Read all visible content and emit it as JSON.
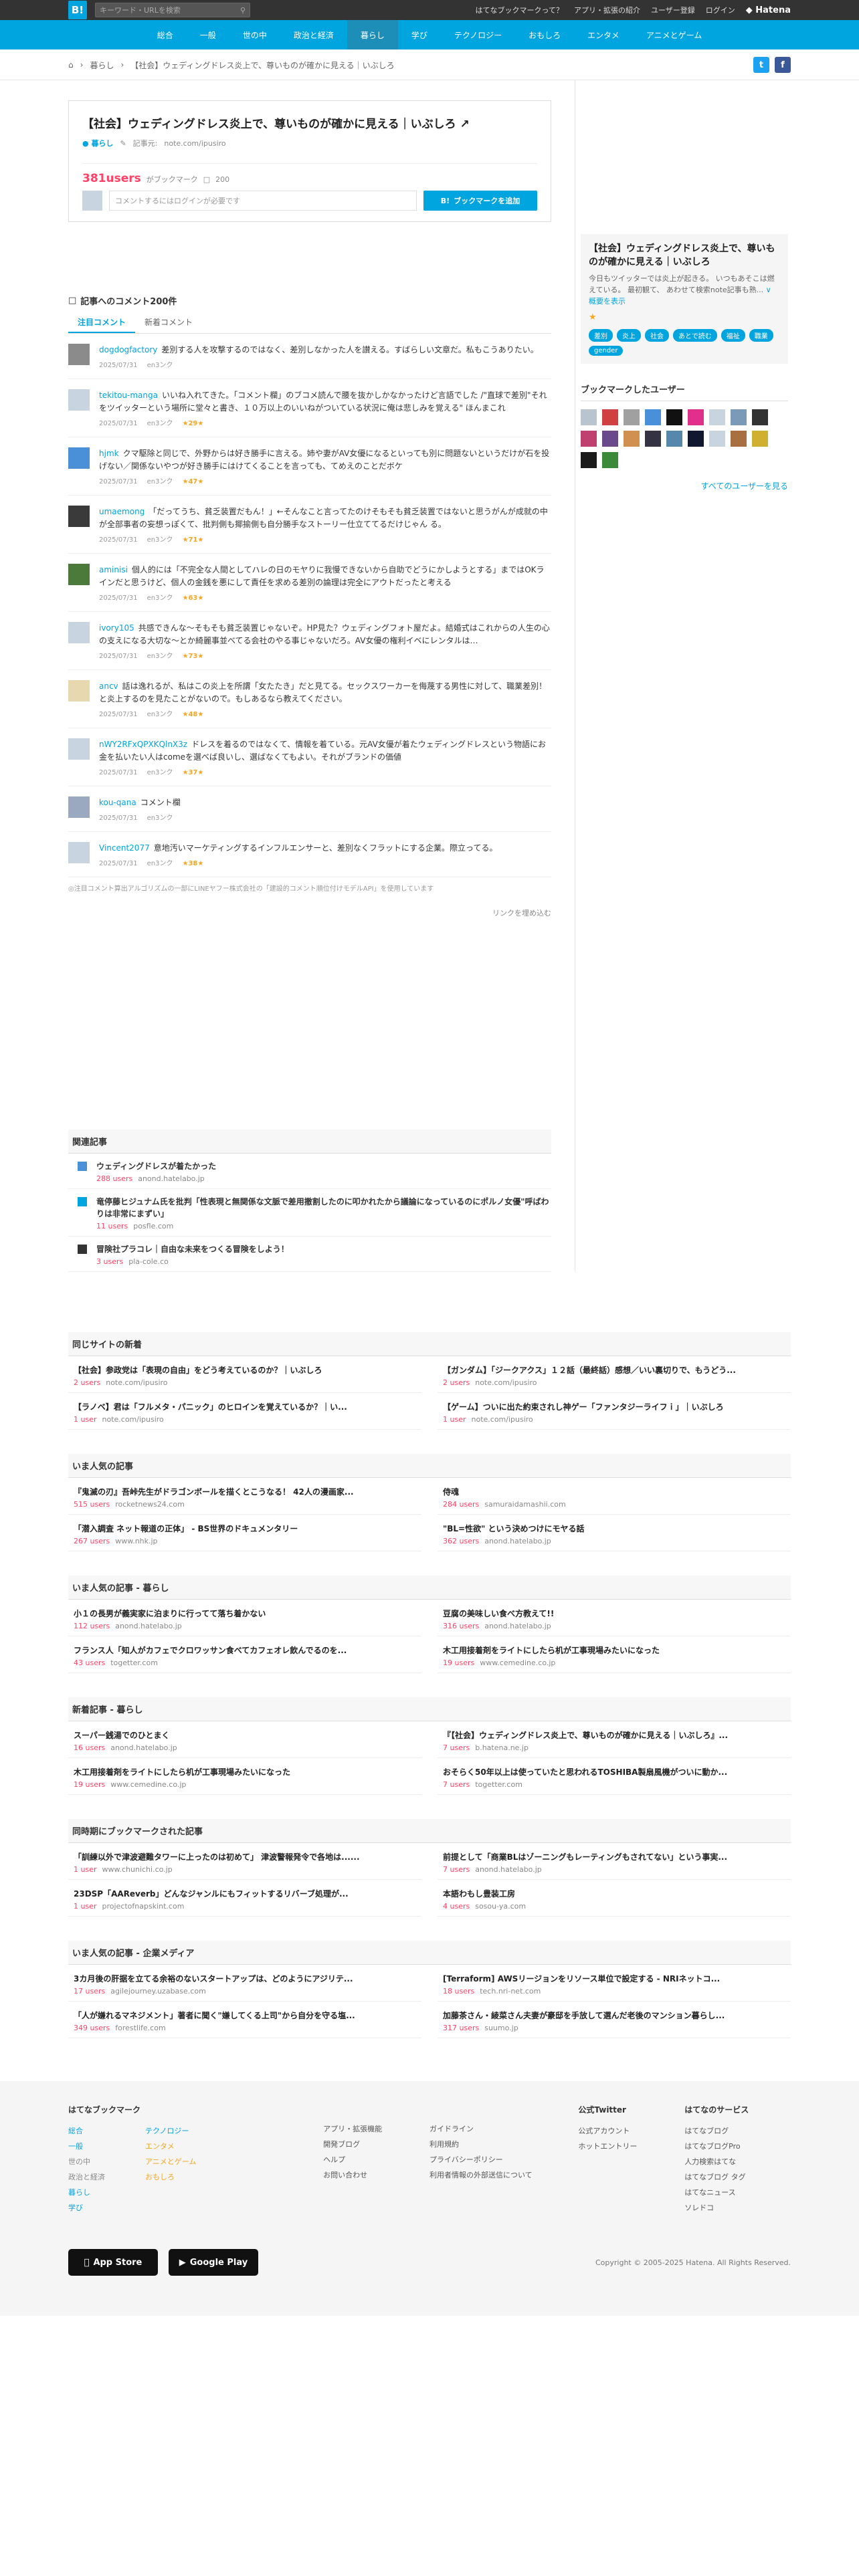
{
  "topbar": {
    "logo": "B!",
    "search_placeholder": "キーワード・URLを検索",
    "links": [
      "はてなブックマークって？",
      "アプリ・拡張の紹介",
      "ユーザー登録",
      "ログイン"
    ],
    "brand": "Hatena"
  },
  "categories": [
    "総合",
    "一般",
    "世の中",
    "政治と経済",
    "暮らし",
    "学び",
    "テクノロジー",
    "おもしろ",
    "エンタメ",
    "アニメとゲーム"
  ],
  "breadcrumb": {
    "section": "暮らし",
    "title": "【社会】ウェディングドレス炎上で、尊いものが確かに見える｜いぶしろ"
  },
  "entry": {
    "title": "【社会】ウェディングドレス炎上で、尊いものが確かに見える｜いぶしろ",
    "category": "暮らし",
    "meta_label": "記事元:",
    "domain": "note.com/ipusiro",
    "users": "381users",
    "users_suffix": "がブックマーク",
    "comment_count": "200",
    "comment_placeholder": "コメントするにはログインが必要です",
    "add_button": "ブックマークを追加"
  },
  "comments_section": {
    "heading": "記事へのコメント200件",
    "tab_popular": "注目コメント",
    "tab_new": "新着コメント",
    "items": [
      {
        "user": "dogdogfactory",
        "text": "差別する人を攻撃するのではなく、差別しなかった人を讃える。すばらしい文章だ。私もこうありたい。",
        "date": "2025/07/31",
        "link": "en3ンク",
        "stars": ""
      },
      {
        "user": "tekitou-manga",
        "text": "いいね入れてきた。「コメント欄」のブコメ読んで腰を抜かしかなかったけど言語でした /\"直球で差別\"それをツイッターという場所に堂々と書き、１０万以上のいいねがついている状況に俺は悲しみを覚える\" ほんまこれ",
        "date": "2025/07/31",
        "link": "en3ンク",
        "stars": "★29★"
      },
      {
        "user": "hjmk",
        "text": "クマ駆除と同じで、外野からは好き勝手に言える。姉や妻がAV女優になるといっても別に問題ないというだけが石を投げない／関係ないやつが好き勝手にはけてくることを言っても、てめえのことだボケ",
        "date": "2025/07/31",
        "link": "en3ンク",
        "stars": "★47★"
      },
      {
        "user": "umaemong",
        "text": "「だってうち、貧乏装置だもん！」←そんなこと言ってたのけそもそも貧乏装置ではないと思うがんが成就の中が全部事者の妄想っぽくて、批判側も揶揄側も自分勝手なストーリー仕立ててるだけじゃん る。",
        "date": "2025/07/31",
        "link": "en3ンク",
        "stars": "★71★"
      },
      {
        "user": "aminisi",
        "text": "個人的には「不完全な人間としてハレの日のモヤりに我慢できないから自助でどうにかしようとする」まではOKラインだと思うけど、個人の金銭を悪にして責任を求める差別の論理は完全にアウトだったと考える",
        "date": "2025/07/31",
        "link": "en3ンク",
        "stars": "★63★"
      },
      {
        "user": "ivory105",
        "text": "共感できんな～そもそも貧乏装置じゃないぞ。HP見た？ウェディングフォト屋だよ。結婚式はこれからの人生の心の支えになる大切な～とか綺麗事並べてる会社のやる事じゃないだろ。AV女優の権利イベにレンタルは…",
        "date": "2025/07/31",
        "link": "en3ンク",
        "stars": "★73★"
      },
      {
        "user": "ancv",
        "text": "話は逸れるが、私はこの炎上を所謂「女たたき」だと見てる。セックスワーカーを侮蔑する男性に対して、職業差別！と炎上するのを見たことがないので。もしあるなら教えてください。",
        "date": "2025/07/31",
        "link": "en3ンク",
        "stars": "★48★"
      },
      {
        "user": "nWY2RFxQPXKQlnX3z",
        "text": "ドレスを着るのではなくて、情報を着ている。元AV女優が着たウェディングドレスという物語にお金を払いたい人はcomeを選べば良いし、選ばなくてもよい。それがブランドの価値",
        "date": "2025/07/31",
        "link": "en3ンク",
        "stars": "★37★"
      },
      {
        "user": "kou-qana",
        "text": "コメント欄",
        "date": "2025/07/31",
        "link": "en3ンク",
        "stars": ""
      },
      {
        "user": "Vincent2077",
        "text": "意地汚いマーケティングするインフルエンサーと、差別なくフラットにする企業。際立ってる。",
        "date": "2025/07/31",
        "link": "en3ンク",
        "stars": "★38★"
      }
    ],
    "note": "◎注目コメント算出アルゴリズムの一部にLINEヤフー株式会社の「建設的コメント順位付けモデルAPI」を使用しています",
    "more": "リンクを埋め込む"
  },
  "related": {
    "heading": "関連記事",
    "items": [
      {
        "title": "ウェディングドレスが着たかった",
        "users": "288 users",
        "domain": "anond.hatelabo.jp"
      },
      {
        "title": "竜停藤ヒジュナム氏を批判「性表現と無関係な文脈で差用撤割したのに叩かれたから議論になっているのにポルノ女優\"呼ばわりは非常にまずい」",
        "users": "11 users",
        "domain": "posfle.com"
      },
      {
        "title": "冒険社プラコレ｜自由な未来をつくる冒険をしよう！",
        "users": "3 users",
        "domain": "pla-cole.co"
      }
    ]
  },
  "sidebar": {
    "title": "【社会】ウェディングドレス炎上で、尊いものが確かに見える｜いぶしろ",
    "desc": "今日もツイッターでは炎上が起きる。 いつもあそこは燃えている。 最初観て、 あわせて検索note記事も熟...",
    "more_link": "概要を表示",
    "star": "★",
    "tags": [
      "差別",
      "炎上",
      "社会",
      "あとで読む",
      "福祉",
      "職業",
      "gender"
    ],
    "bookmark_users_heading": "ブックマークしたユーザー",
    "all_users": "すべてのユーザーを見る"
  },
  "lower_sections": [
    {
      "heading": "同じサイトの新着",
      "items": [
        {
          "title": "【社会】参政党は「表現の自由」をどう考えているのか？｜いぶしろ",
          "users": "2 users",
          "domain": "note.com/ipusiro"
        },
        {
          "title": "【ガンダム】「ジークアクス」１２話（最終話）感想／いい裏切りで、もうどう...",
          "users": "2 users",
          "domain": "note.com/ipusiro"
        },
        {
          "title": "【ラノベ】君は「フルメタ・パニック」のヒロインを覚えているか？｜い...",
          "users": "1 user",
          "domain": "note.com/ipusiro"
        },
        {
          "title": "【ゲーム】ついに出た約束されし神ゲー「ファンタジーライフｉ」｜いぶしろ",
          "users": "1 user",
          "domain": "note.com/ipusiro"
        }
      ]
    },
    {
      "heading": "いま人気の記事",
      "items": [
        {
          "title": "『鬼滅の刃』吾峠先生がドラゴンボールを描くとこうなる！ 42人の漫画家...",
          "users": "515 users",
          "domain": "rocketnews24.com"
        },
        {
          "title": "侍魂",
          "users": "284 users",
          "domain": "samuraidamashii.com"
        },
        {
          "title": "「潜入調査 ネット報道の正体」 - BS世界のドキュメンタリー",
          "users": "267 users",
          "domain": "www.nhk.jp"
        },
        {
          "title": "\"BL=性欲\" という決めつけにモヤる話",
          "users": "362 users",
          "domain": "anond.hatelabo.jp"
        }
      ]
    },
    {
      "heading": "いま人気の記事 - 暮らし",
      "items": [
        {
          "title": "小１の長男が義実家に泊まりに行ってて落ち着かない",
          "users": "112 users",
          "domain": "anond.hatelabo.jp"
        },
        {
          "title": "豆腐の美味しい食べ方教えて!!",
          "users": "316 users",
          "domain": "anond.hatelabo.jp"
        },
        {
          "title": "フランス人「知人がカフェでクロワッサン食べてカフェオレ飲んでるのを...",
          "users": "43 users",
          "domain": "togetter.com"
        },
        {
          "title": "木工用接着剤をライトにしたら机が工事現場みたいになった",
          "users": "19 users",
          "domain": "www.cemedine.co.jp"
        }
      ]
    },
    {
      "heading": "新着記事 - 暮らし",
      "items": [
        {
          "title": "スーパー銭湯でのひとまく",
          "users": "16 users",
          "domain": "anond.hatelabo.jp"
        },
        {
          "title": "『【社会】ウェディングドレス炎上で、尊いものが確かに見える｜いぶしろ』...",
          "users": "7 users",
          "domain": "b.hatena.ne.jp"
        },
        {
          "title": "木工用接着剤をライトにしたら机が工事現場みたいになった",
          "users": "19 users",
          "domain": "www.cemedine.co.jp"
        },
        {
          "title": "おそらく50年以上は使っていたと思われるTOSHIBA製扇風機がついに動か...",
          "users": "7 users",
          "domain": "togetter.com"
        }
      ]
    },
    {
      "heading": "同時期にブックマークされた記事",
      "items": [
        {
          "title": "「訓練以外で津波避難タワーに上ったのは初めて」 津波警報発令で各地は......",
          "users": "1 user",
          "domain": "www.chunichi.co.jp"
        },
        {
          "title": "前提として「商業BLはゾーニングもレーティングもされてない」という事実...",
          "users": "7 users",
          "domain": "anond.hatelabo.jp"
        },
        {
          "title": "23DSP「AAReverb」どんなジャンルにもフィットするリバーブ処理が...",
          "users": "1 user",
          "domain": "projectofnapskint.com"
        },
        {
          "title": "本語わもし豊装工房",
          "users": "4 users",
          "domain": "sosou-ya.com"
        }
      ]
    },
    {
      "heading": "いま人気の記事 - 企業メディア",
      "items": [
        {
          "title": "3カ月後の肝据を立てる余裕のないスタートアップは、どのようにアジリテ...",
          "users": "17 users",
          "domain": "agilejourney.uzabase.com"
        },
        {
          "title": "[Terraform] AWSリージョンをリソース単位で設定する - NRIネットコ...",
          "users": "18 users",
          "domain": "tech.nri-net.com"
        },
        {
          "title": "「人が嫌れるマネジメント」著者に聞く\"嫌してくる上司\"から自分を守る塩...",
          "users": "349 users",
          "domain": "forestlife.com"
        },
        {
          "title": "加藤茶さん・綾菜さん夫妻が豪邸を手放して選んだ老後のマンション暮らし...",
          "users": "317 users",
          "domain": "suumo.jp"
        }
      ]
    }
  ],
  "footer": {
    "col1_heading": "はてなブックマーク",
    "col1a": [
      "総合",
      "一般",
      "世の中",
      "政治と経済",
      "暮らし",
      "学び"
    ],
    "col1b": [
      "テクノロジー",
      "エンタメ",
      "アニメとゲーム",
      "おもしろ"
    ],
    "col2": [
      "アプリ・拡張機能",
      "開発ブログ",
      "ヘルプ",
      "お問い合わせ"
    ],
    "col3": [
      "ガイドライン",
      "利用規約",
      "プライバシーポリシー",
      "利用者情報の外部送信について"
    ],
    "col4_heading": "公式Twitter",
    "col4": [
      "公式アカウント",
      "ホットエントリー"
    ],
    "col5_heading": "はてなのサービス",
    "col5": [
      "はてなブログ",
      "はてなブログPro",
      "人力検索はてな",
      "はてなブログ タグ",
      "はてなニュース",
      "ソレドコ"
    ],
    "app_store": "App Store",
    "google_play": "Google Play",
    "copyright": "Copyright © 2005-2025 Hatena. All Rights Reserved."
  }
}
